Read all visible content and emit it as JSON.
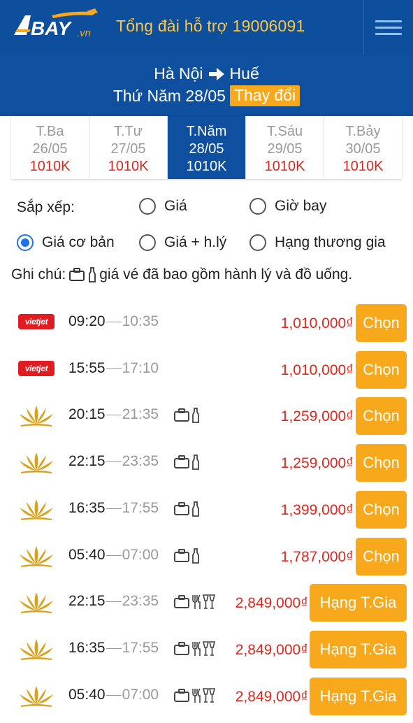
{
  "header": {
    "logo_text": "BAY",
    "logo_suffix": ".vn",
    "hotline": "Tổng đài hỗ trợ 19006091"
  },
  "route": {
    "from": "Hà Nội",
    "to": "Huế",
    "date": "Thứ Năm 28/05",
    "change_label": "Thay đổi"
  },
  "days": [
    {
      "name": "T.Ba",
      "date": "26/05",
      "price": "1010K"
    },
    {
      "name": "T.Tư",
      "date": "27/05",
      "price": "1010K"
    },
    {
      "name": "T.Năm",
      "date": "28/05",
      "price": "1010K",
      "active": true
    },
    {
      "name": "T.Sáu",
      "date": "29/05",
      "price": "1010K"
    },
    {
      "name": "T.Bảy",
      "date": "30/05",
      "price": "1010K"
    }
  ],
  "sort": {
    "label": "Sắp xếp:",
    "options": [
      {
        "label": "Giá",
        "checked": false
      },
      {
        "label": "Giờ bay",
        "checked": false
      },
      {
        "label": "Giá cơ bản",
        "checked": true
      },
      {
        "label": "Giá + h.lý",
        "checked": false
      },
      {
        "label": "Hạng thương gia",
        "checked": false
      }
    ]
  },
  "note": {
    "prefix": "Ghi chú:",
    "text": "giá vé đã bao gồm hành lý và đồ uống."
  },
  "flights": [
    {
      "airline": "vietjet",
      "dep": "09:20",
      "arr": "10:35",
      "amenities": [],
      "price": "1,010,000₫",
      "button": "Chọn"
    },
    {
      "airline": "vietjet",
      "dep": "15:55",
      "arr": "17:10",
      "amenities": [],
      "price": "1,010,000₫",
      "button": "Chọn"
    },
    {
      "airline": "vietnam-airlines",
      "dep": "20:15",
      "arr": "21:35",
      "amenities": [
        "luggage",
        "drink"
      ],
      "price": "1,259,000₫",
      "button": "Chọn"
    },
    {
      "airline": "vietnam-airlines",
      "dep": "22:15",
      "arr": "23:35",
      "amenities": [
        "luggage",
        "drink"
      ],
      "price": "1,259,000₫",
      "button": "Chọn"
    },
    {
      "airline": "vietnam-airlines",
      "dep": "16:35",
      "arr": "17:55",
      "amenities": [
        "luggage",
        "drink"
      ],
      "price": "1,399,000₫",
      "button": "Chọn"
    },
    {
      "airline": "vietnam-airlines",
      "dep": "05:40",
      "arr": "07:00",
      "amenities": [
        "luggage",
        "drink"
      ],
      "price": "1,787,000₫",
      "button": "Chọn"
    },
    {
      "airline": "vietnam-airlines",
      "dep": "22:15",
      "arr": "23:35",
      "amenities": [
        "luggage",
        "meal",
        "drinks"
      ],
      "price": "2,849,000₫",
      "button": "Hạng T.Gia"
    },
    {
      "airline": "vietnam-airlines",
      "dep": "16:35",
      "arr": "17:55",
      "amenities": [
        "luggage",
        "meal",
        "drinks"
      ],
      "price": "2,849,000₫",
      "button": "Hạng T.Gia"
    },
    {
      "airline": "vietnam-airlines",
      "dep": "05:40",
      "arr": "07:00",
      "amenities": [
        "luggage",
        "meal",
        "drinks"
      ],
      "price": "2,849,000₫",
      "button": "Hạng T.Gia"
    }
  ],
  "vietjet_logo_text": "vietjet",
  "colors": {
    "header_bg": "#0d4f9c",
    "hotline": "#ffc53d",
    "accent_button": "#f7a81b",
    "price": "#e0261c",
    "radio_checked": "#1e73e8"
  }
}
